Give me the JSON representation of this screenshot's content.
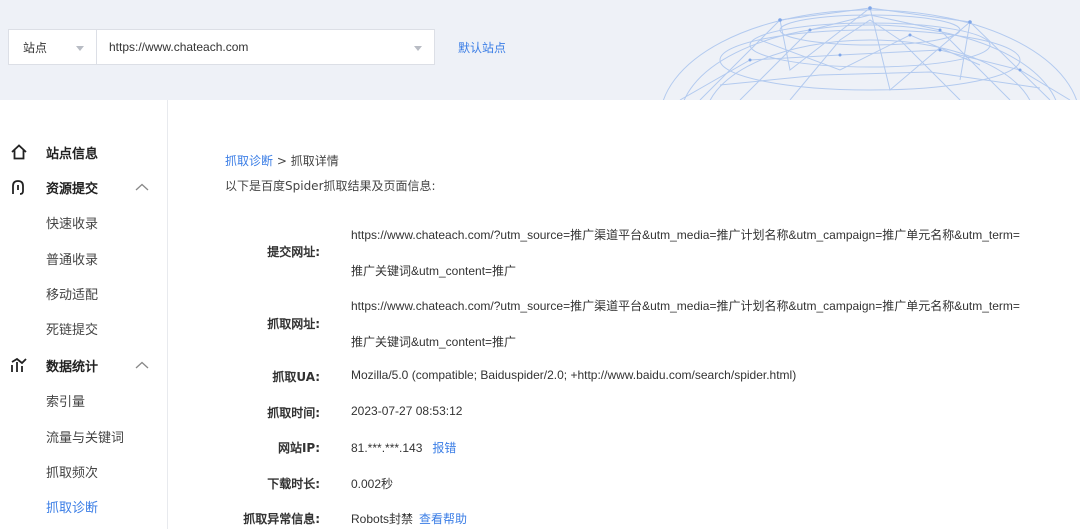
{
  "header": {
    "site_select_label": "站点",
    "url_value": "https://www.chateach.com",
    "default_site_label": "默认站点",
    "accent_color": "#3b7ee6"
  },
  "sidebar": {
    "groups": [
      {
        "label": "站点信息",
        "icon": "home-icon"
      },
      {
        "label": "资源提交",
        "icon": "upload-icon",
        "expanded": true,
        "items": [
          "快速收录",
          "普通收录",
          "移动适配",
          "死链提交"
        ]
      },
      {
        "label": "数据统计",
        "icon": "stats-icon",
        "expanded": true,
        "items": [
          "索引量",
          "流量与关键词",
          "抓取频次",
          "抓取诊断"
        ]
      }
    ],
    "active_item": "抓取诊断"
  },
  "main": {
    "breadcrumb": {
      "link": "抓取诊断",
      "separator": " > ",
      "current": "抓取详情"
    },
    "intro": "以下是百度Spider抓取结果及页面信息:",
    "rows": [
      {
        "label": "提交网址:",
        "line1": "https://www.chateach.com/?utm_source=推广渠道平台&utm_media=推广计划名称&utm_campaign=推广单元名称&utm_term=",
        "line2": "推广关键词&utm_content=推广"
      },
      {
        "label": "抓取网址:",
        "line1": "https://www.chateach.com/?utm_source=推广渠道平台&utm_media=推广计划名称&utm_campaign=推广单元名称&utm_term=",
        "line2": "推广关键词&utm_content=推广"
      },
      {
        "label": "抓取UA:",
        "value": "Mozilla/5.0 (compatible; Baiduspider/2.0; +http://www.baidu.com/search/spider.html)"
      },
      {
        "label": "抓取时间:",
        "value": "2023-07-27 08:53:12"
      },
      {
        "label": "网站IP:",
        "value": "81.***.***.143",
        "link": "报错"
      },
      {
        "label": "下载时长:",
        "value": "0.002秒"
      },
      {
        "label": "抓取异常信息:",
        "value": "Robots封禁",
        "link": "查看帮助"
      }
    ]
  }
}
